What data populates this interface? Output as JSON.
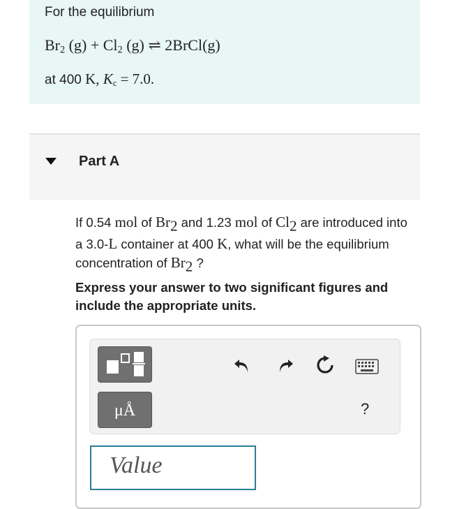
{
  "intro": {
    "lead": "For the equilibrium",
    "equation": {
      "reactant1": "Br",
      "reactant1_sub": "2",
      "reactant1_state": "(g)",
      "plus": "+",
      "reactant2": "Cl",
      "reactant2_sub": "2",
      "reactant2_state": "(g)",
      "arrow": "⇌",
      "product": "2BrCl(g)"
    },
    "condition_prefix": "at 400",
    "condition_unit": "K,",
    "kc_symbol": "K",
    "kc_sub": "c",
    "kc_value": "= 7.0."
  },
  "part": {
    "title": "Part A"
  },
  "question": {
    "t1": "If 0.54",
    "u1": "mol",
    "t2": "of",
    "s1": "Br",
    "s1_sub": "2",
    "t3": "and 1.23",
    "u2": "mol",
    "t4": "of",
    "s2": "Cl",
    "s2_sub": "2",
    "t5": "are introduced into a 3.0-",
    "u3": "L",
    "t6": "container at 400",
    "u4": "K",
    "t7": ", what will be the equilibrium concentration of",
    "s3": "Br",
    "s3_sub": "2",
    "t8": "?"
  },
  "instruction": "Express your answer to two significant figures and include the appropriate units.",
  "toolbar": {
    "units_label": "μÅ",
    "help_label": "?"
  },
  "input": {
    "placeholder": "Value"
  }
}
